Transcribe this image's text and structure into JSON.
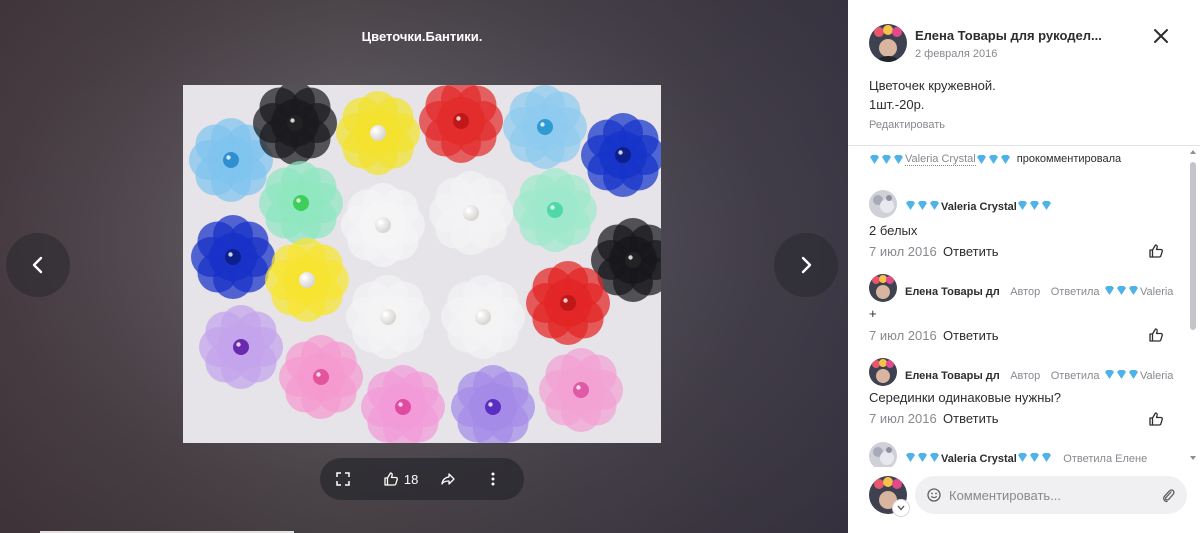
{
  "viewer": {
    "album_title": "Цветочки.Бантики.",
    "likes_count": "18",
    "icons": [
      "fullscreen-icon",
      "like-icon",
      "share-icon",
      "more-icon",
      "chevron-left-icon",
      "chevron-right-icon"
    ]
  },
  "post": {
    "author": "Елена Товары для рукодел...",
    "date": "2 февраля 2016",
    "description_line1": "Цветочек кружевной.",
    "description_line2": "1шт.-20р.",
    "edit_label": "Редактировать"
  },
  "comments": {
    "header_name": "Valeria Crystal",
    "header_action": "прокомментировала",
    "reply_label": "Ответить",
    "items": [
      {
        "name": "Valeria Crystal",
        "text": "2 белых",
        "date": "7 июл 2016"
      },
      {
        "name": "Елена Товары дл",
        "badge": "Автор",
        "reply_to": "Ответила",
        "reply_target": "Valeria",
        "text": "+",
        "date": "7 июл 2016"
      },
      {
        "name": "Елена Товары дл",
        "badge": "Автор",
        "reply_to": "Ответила",
        "reply_target": "Valeria",
        "text": "Серединки одинаковые нужны?",
        "date": "7 июл 2016"
      },
      {
        "name": "Valeria Crystal",
        "reply_to": "Ответила Елене"
      }
    ]
  },
  "composer": {
    "placeholder": "Комментировать..."
  },
  "colors": {
    "gem": "#4fb3e8",
    "text": "#2c2d2e",
    "muted": "#87898f"
  }
}
